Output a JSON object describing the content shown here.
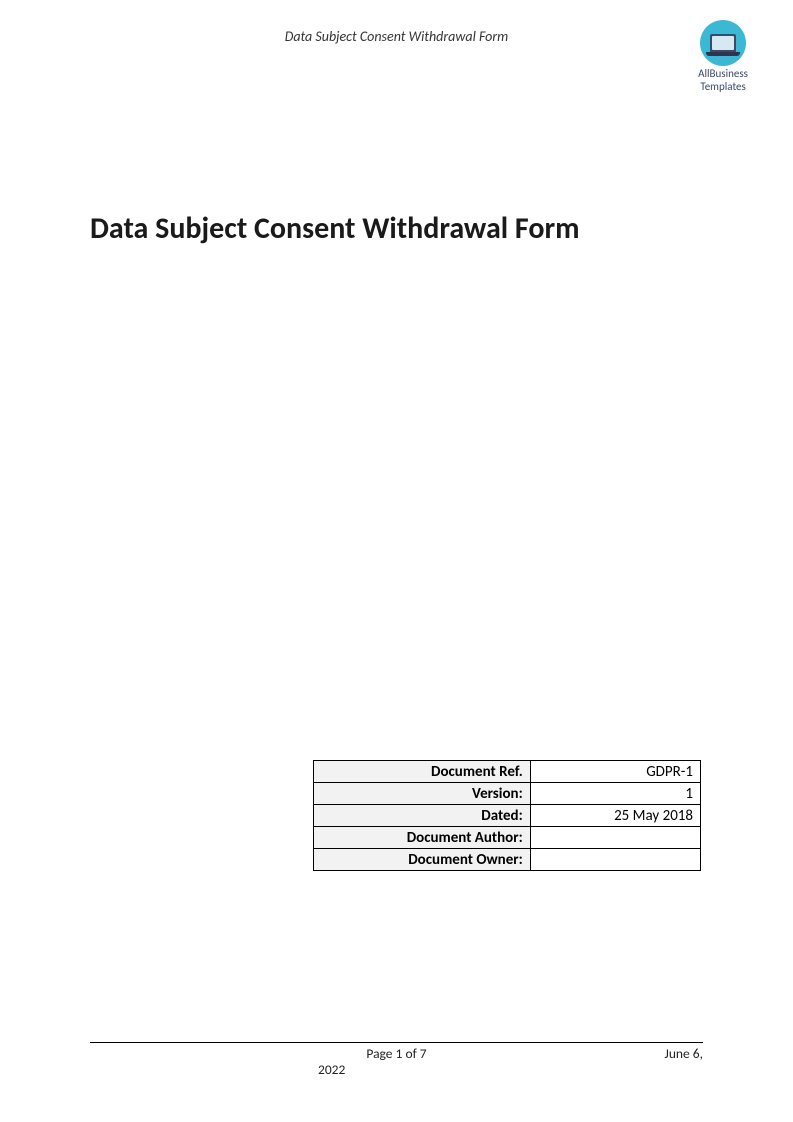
{
  "header": {
    "title": "Data Subject Consent Withdrawal Form"
  },
  "logo": {
    "line1": "AllBusiness",
    "line2": "Templates"
  },
  "main": {
    "title": "Data Subject Consent Withdrawal Form"
  },
  "meta": {
    "rows": [
      {
        "label": "Document Ref.",
        "value": "GDPR-1"
      },
      {
        "label": "Version:",
        "value": "1"
      },
      {
        "label": "Dated:",
        "value": "25 May 2018"
      },
      {
        "label": "Document Author:",
        "value": ""
      },
      {
        "label": "Document Owner:",
        "value": ""
      }
    ]
  },
  "footer": {
    "page": "Page 1 of 7",
    "date": "June 6,",
    "year": "2022"
  }
}
